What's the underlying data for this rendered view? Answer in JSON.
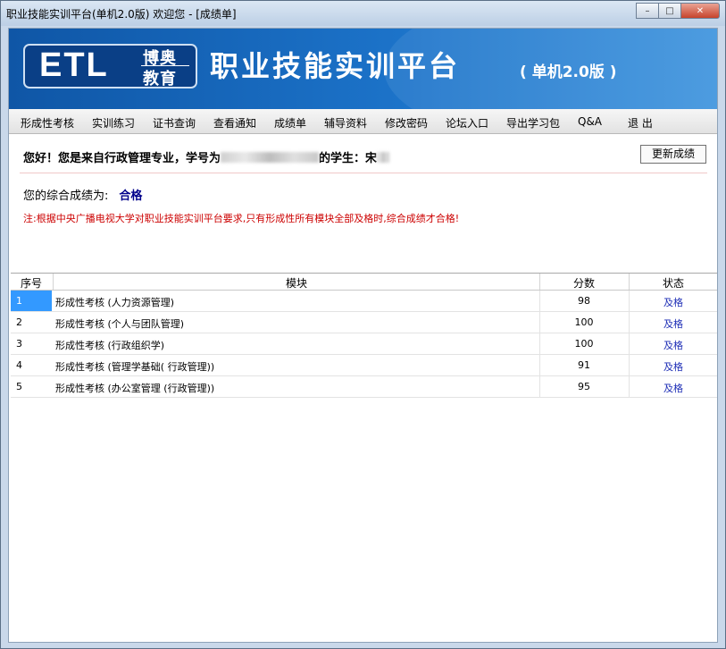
{
  "window": {
    "title": "职业技能实训平台(单机2.0版)  欢迎您 - [成绩单]"
  },
  "banner": {
    "logo_etl": "ETL",
    "logo_line1": "博奥",
    "logo_line2": "教育",
    "title": "职业技能实训平台",
    "subtitle": "( 单机2.0版 )"
  },
  "menu": [
    "形成性考核",
    "实训练习",
    "证书查询",
    "查看通知",
    "成绩单",
    "辅导资料",
    "修改密码",
    "论坛入口",
    "导出学习包",
    "Q&A",
    "退 出"
  ],
  "greeting": {
    "prefix": "您好！您是来自行政管理专业，学号为",
    "middle": "的学生：宋"
  },
  "update_button": "更新成绩",
  "score": {
    "label": "您的综合成绩为:",
    "value": "合格"
  },
  "note": "注:根据中央广播电视大学对职业技能实训平台要求,只有形成性所有模块全部及格时,综合成绩才合格!",
  "table": {
    "headers": [
      "序号",
      "模块",
      "分数",
      "状态"
    ],
    "rows": [
      {
        "idx": "1",
        "module": "形成性考核 (人力资源管理)",
        "score": "98",
        "status": "及格"
      },
      {
        "idx": "2",
        "module": "形成性考核 (个人与团队管理)",
        "score": "100",
        "status": "及格"
      },
      {
        "idx": "3",
        "module": "形成性考核 (行政组织学)",
        "score": "100",
        "status": "及格"
      },
      {
        "idx": "4",
        "module": "形成性考核 (管理学基础( 行政管理))",
        "score": "91",
        "status": "及格"
      },
      {
        "idx": "5",
        "module": "形成性考核 (办公室管理 (行政管理))",
        "score": "95",
        "status": "及格"
      }
    ]
  }
}
